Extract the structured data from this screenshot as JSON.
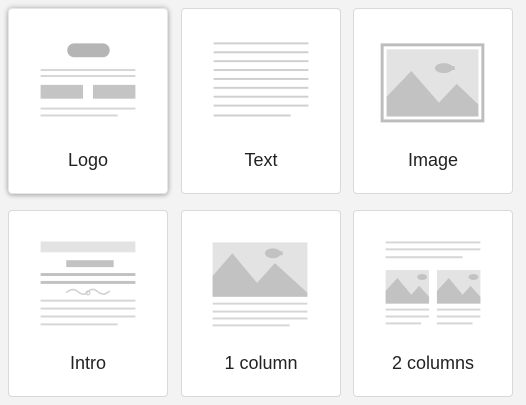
{
  "templates": [
    {
      "label": "Logo",
      "selected": true
    },
    {
      "label": "Text",
      "selected": false
    },
    {
      "label": "Image",
      "selected": false
    },
    {
      "label": "Intro",
      "selected": false
    },
    {
      "label": "1 column",
      "selected": false
    },
    {
      "label": "2 columns",
      "selected": false
    }
  ],
  "colors": {
    "background": "#f3f3f3",
    "card": "#ffffff",
    "card_border": "#d9d9d9",
    "placeholder_gray": "#c8c8c8",
    "placeholder_light": "#e3e3e3",
    "label_text": "#222222"
  },
  "icons": [
    "logo-layout-icon",
    "text-layout-icon",
    "image-layout-icon",
    "intro-layout-icon",
    "one-column-layout-icon",
    "two-columns-layout-icon"
  ]
}
